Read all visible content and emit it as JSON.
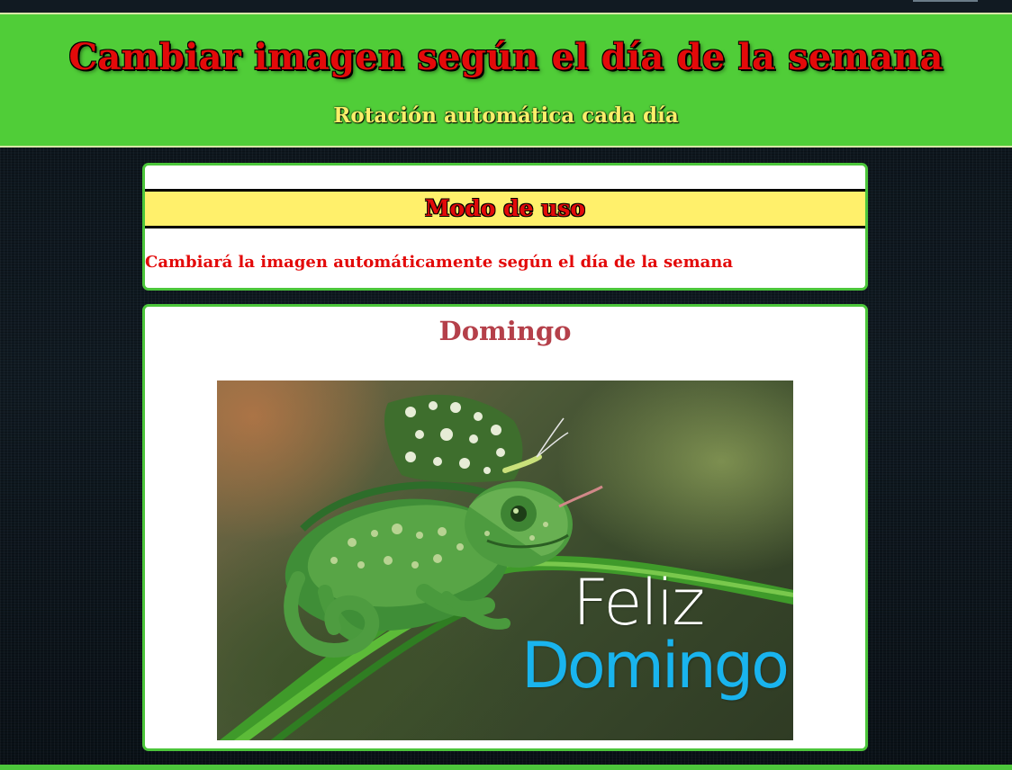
{
  "header": {
    "title": "Cambiar imagen según el día de la semana",
    "subtitle": "Rotación automática cada día"
  },
  "usage": {
    "heading": "Modo de uso",
    "description": "Cambiará la imagen automáticamente según el día de la semana"
  },
  "day": {
    "name": "Domingo",
    "image_text_line1": "Feliz",
    "image_text_line2": "Domingo"
  },
  "colors": {
    "header_bg": "#50cd38",
    "title_red": "#e30a0a",
    "subtitle_yellow": "#fbef6a",
    "usage_bar_bg": "#fff06b",
    "panel_border": "#4cc63b",
    "day_title": "#b5404a",
    "image_text_blue": "#19b4ee"
  }
}
